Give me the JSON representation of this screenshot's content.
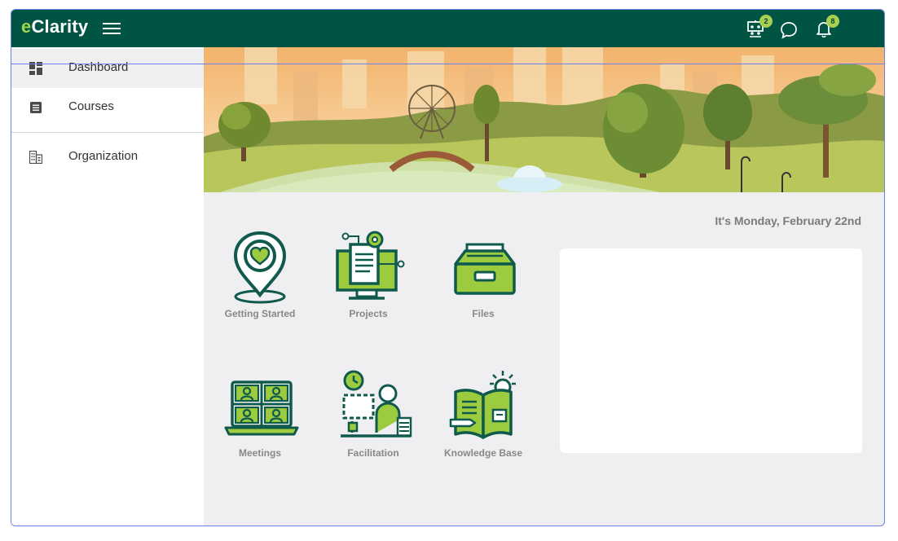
{
  "brand": {
    "prefix": "e",
    "rest": "Clarity"
  },
  "header": {
    "badges": {
      "projects": "2",
      "notifications": "8"
    }
  },
  "sidebar": {
    "items": [
      {
        "label": "Dashboard",
        "icon": "dashboard-icon"
      },
      {
        "label": "Courses",
        "icon": "courses-icon"
      },
      {
        "label": "Organization",
        "icon": "organization-icon"
      }
    ]
  },
  "main": {
    "date": "It's Monday, February 22nd",
    "tiles": [
      {
        "label": "Getting Started",
        "icon": "location-heart-icon"
      },
      {
        "label": "Projects",
        "icon": "monitor-document-icon"
      },
      {
        "label": "Files",
        "icon": "file-drawer-icon"
      },
      {
        "label": "Meetings",
        "icon": "video-meeting-icon"
      },
      {
        "label": "Facilitation",
        "icon": "presenter-icon"
      },
      {
        "label": "Knowledge Base",
        "icon": "book-lightbulb-icon"
      }
    ]
  },
  "colors": {
    "header": "#005443",
    "accent": "#a9cf52",
    "icon_stroke": "#0f5a4c",
    "background": "#efeff1"
  }
}
